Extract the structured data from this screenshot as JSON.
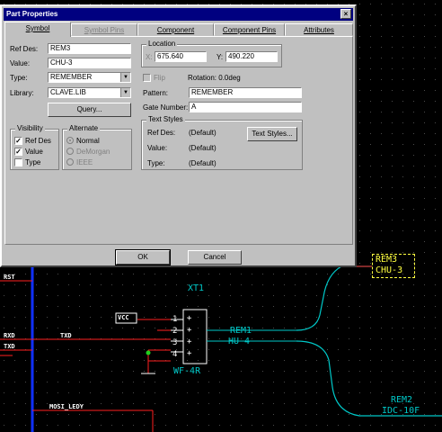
{
  "dialog": {
    "title": "Part Properties",
    "close_glyph": "×",
    "tabs": [
      {
        "label": "Symbol",
        "active": true,
        "enabled": true
      },
      {
        "label": "Symbol Pins",
        "active": false,
        "enabled": false
      },
      {
        "label": "Component",
        "active": false,
        "enabled": true
      },
      {
        "label": "Component Pins",
        "active": false,
        "enabled": true
      },
      {
        "label": "Attributes",
        "active": false,
        "enabled": true
      }
    ],
    "ref_des": {
      "label": "Ref Des:",
      "value": "REM3"
    },
    "value": {
      "label": "Value:",
      "value": "CHU-3"
    },
    "type": {
      "label": "Type:",
      "value": "REMEMBER"
    },
    "library": {
      "label": "Library:",
      "value": "CLAVE.LIB"
    },
    "query_button": "Query...",
    "location": {
      "group": "Location",
      "x_label": "X:",
      "x_value": "675.640",
      "y_label": "Y:",
      "y_value": "490.220"
    },
    "flip_label": "Flip",
    "rotation": "Rotation:  0.0deg",
    "pattern": {
      "label": "Pattern:",
      "value": "REMEMBER"
    },
    "gate_number": {
      "label": "Gate Number:",
      "value": "A"
    },
    "text_styles": {
      "group": "Text Styles",
      "rows": [
        {
          "label": "Ref Des:",
          "value": "(Default)"
        },
        {
          "label": "Value:",
          "value": "(Default)"
        },
        {
          "label": "Type:",
          "value": "(Default)"
        }
      ],
      "button": "Text Styles..."
    },
    "visibility": {
      "group": "Visibility",
      "items": [
        {
          "label": "Ref Des",
          "checked": true
        },
        {
          "label": "Value",
          "checked": true
        },
        {
          "label": "Type",
          "checked": false
        }
      ]
    },
    "alternate": {
      "group": "Alternate",
      "items": [
        {
          "label": "Normal",
          "selected": true
        },
        {
          "label": "DeMorgan",
          "selected": false
        },
        {
          "label": "IEEE",
          "selected": false
        }
      ]
    },
    "ok_button": "OK",
    "cancel_button": "Cancel"
  },
  "schematic": {
    "colors": {
      "wire": "#ff2020",
      "bus": "#1030ff",
      "cyan": "#00c8c8",
      "yellow": "#ffff40",
      "white": "#ffffff"
    },
    "selected_label": {
      "ref": "REM3",
      "value": "CHU-3"
    },
    "rem1": {
      "ref": "REM1",
      "value": "HU-4"
    },
    "rem2": {
      "ref": "REM2",
      "value": "IDC-10F"
    },
    "connector": {
      "ref": "XT1",
      "value": "WF-4R",
      "pins": [
        "1",
        "2",
        "3",
        "4"
      ],
      "pin_marks": [
        "+",
        "+",
        "+",
        "+"
      ]
    },
    "vcc_label": "VCC",
    "nets": {
      "rst": "RST",
      "rxd": "RXD",
      "txd_left": "TXD",
      "txd": "TXD",
      "mosi": "MOSI_LEDY"
    }
  }
}
